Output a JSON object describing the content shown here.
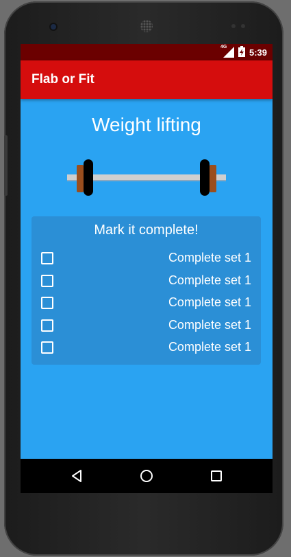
{
  "status_bar": {
    "network": "4G",
    "time": "5:39"
  },
  "app_bar": {
    "title": "Flab or Fit"
  },
  "main": {
    "heading": "Weight lifting",
    "checklist": {
      "title": "Mark it complete!",
      "items": [
        {
          "label": "Complete set 1",
          "checked": false
        },
        {
          "label": "Complete set 1",
          "checked": false
        },
        {
          "label": "Complete set 1",
          "checked": false
        },
        {
          "label": "Complete set 1",
          "checked": false
        },
        {
          "label": "Complete set 1",
          "checked": false
        }
      ]
    }
  },
  "nav_bar": {
    "back_icon": "back-triangle-icon",
    "home_icon": "home-circle-icon",
    "recents_icon": "recents-square-icon"
  },
  "colors": {
    "status_bar": "#6b0000",
    "app_bar": "#d50d0d",
    "background": "#2aa3f2",
    "card": "#2b8fd6"
  }
}
